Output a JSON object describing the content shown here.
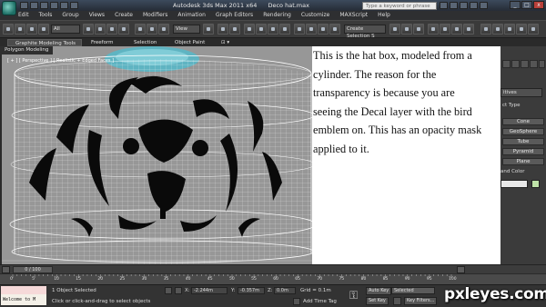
{
  "window": {
    "title_parts": [
      "Autodesk 3ds Max  2011 x64",
      "Deco hat.max"
    ],
    "search_placeholder": "Type a keyword or phrase",
    "controls": [
      "_",
      "□",
      "x"
    ]
  },
  "menu": [
    "Edit",
    "Tools",
    "Group",
    "Views",
    "Create",
    "Modifiers",
    "Animation",
    "Graph Editors",
    "Rendering",
    "Customize",
    "MAXScript",
    "Help"
  ],
  "toolbar": {
    "selection_filter": "All",
    "reference_coord": "View",
    "named_selection_set": "Create Selection S"
  },
  "ribbon": {
    "tabs": [
      "Graphite Modeling Tools",
      "Freeform",
      "Selection",
      "Object Paint"
    ],
    "panel_label": "Polygon Modeling"
  },
  "viewport": {
    "label": "[ + ] [ Perspective ] [ Realistic + Edged Faces ]"
  },
  "command_panel": {
    "dropdown": "itives",
    "object_type_header": "ct Type",
    "buttons": [
      "Cone",
      "GeoSphere",
      "Tube",
      "Pyramid",
      "Plane"
    ],
    "name_color_header": "and Color"
  },
  "caption": {
    "lines": [
      "This is the hat box, modeled from a",
      "cylinder. The reason for the",
      "transparency is because you are",
      "seeing the Decal layer with the bird",
      "emblem on. This has an opacity mask",
      "applied to it."
    ]
  },
  "timeline": {
    "slider": "0 / 100",
    "ticks": [
      "0",
      "5",
      "10",
      "15",
      "20",
      "25",
      "30",
      "35",
      "40",
      "45",
      "50",
      "55",
      "60",
      "65",
      "70",
      "75",
      "80",
      "85",
      "90",
      "95",
      "100"
    ]
  },
  "status": {
    "maxscript": "Welcome to M",
    "selected": "1 Object Selected",
    "prompt": "Click or click-and-drag to select objects",
    "x": "-2.244m",
    "y": "-0.357m",
    "z": "0.0m",
    "grid": "Grid = 0.1m",
    "add_time_tag": "Add Time Tag",
    "auto_key": "Auto Key",
    "auto_key_mode": "Selected",
    "set_key": "Set Key",
    "key_filters": "Key Filters..."
  },
  "watermark": "pxleyes.com",
  "colors": {
    "caption_bg": "#ffffff",
    "viewport_bg": "#8f8f8f",
    "ui_dark": "#3a3a3a",
    "wire": "#ffffff",
    "emblem": "#0a0a0a",
    "hat_top": "#5fb4c2"
  }
}
